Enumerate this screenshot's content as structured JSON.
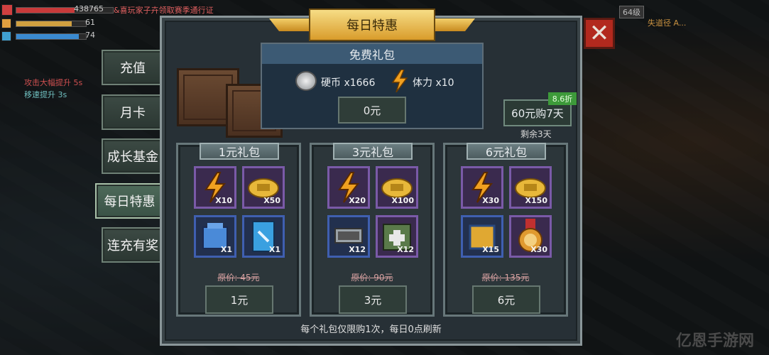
{
  "hud": {
    "hp_value": "438765",
    "shield_value": "61",
    "energy_value": "74",
    "scroll_msg": "&喜玩家子卉领取赛季通行证",
    "buff1": "攻击大幅提升 5s",
    "buff2": "移速提升 3s",
    "level_badge": "64级",
    "level_name": "失道径 A..."
  },
  "tabs": [
    {
      "label": "充值"
    },
    {
      "label": "月卡"
    },
    {
      "label": "成长基金"
    },
    {
      "label": "每日特惠",
      "active": true
    },
    {
      "label": "连充有奖"
    }
  ],
  "title": "每日特惠",
  "free_pack": {
    "title": "免费礼包",
    "coin_label": "硬币 x1666",
    "stamina_label": "体力 x10",
    "price": "0元"
  },
  "deal": {
    "label": "60元购7天",
    "discount": "8.6折",
    "remain": "剩余3天"
  },
  "packs": [
    {
      "title": "1元礼包",
      "items": [
        {
          "icon": "stamina-bolt-icon",
          "qty": "X10"
        },
        {
          "icon": "gold-coin-icon",
          "qty": "X50"
        },
        {
          "icon": "blue-mailbox-icon",
          "qty": "X1"
        },
        {
          "icon": "tool-manual-icon",
          "qty": "X1"
        }
      ],
      "orig": "原价: 45元",
      "price": "1元"
    },
    {
      "title": "3元礼包",
      "items": [
        {
          "icon": "stamina-bolt-icon",
          "qty": "X20"
        },
        {
          "icon": "gold-coin-icon",
          "qty": "X100"
        },
        {
          "icon": "chip-module-icon",
          "qty": "X12"
        },
        {
          "icon": "medkit-icon",
          "qty": "X12"
        }
      ],
      "orig": "原价: 90元",
      "price": "3元"
    },
    {
      "title": "6元礼包",
      "items": [
        {
          "icon": "stamina-bolt-icon",
          "qty": "X30"
        },
        {
          "icon": "gold-coin-icon",
          "qty": "X150"
        },
        {
          "icon": "gold-box-icon",
          "qty": "X15"
        },
        {
          "icon": "dog-medal-icon",
          "qty": "X30"
        }
      ],
      "orig": "原价: 135元",
      "price": "6元"
    }
  ],
  "footer": "每个礼包仅限购1次，每日0点刷新",
  "watermark": "亿恩手游网",
  "colors": {
    "accent_gold": "#e6b44a",
    "close_red": "#b2291e",
    "purple_slot": "#7a5aa8",
    "blue_slot": "#3f5fb0"
  }
}
